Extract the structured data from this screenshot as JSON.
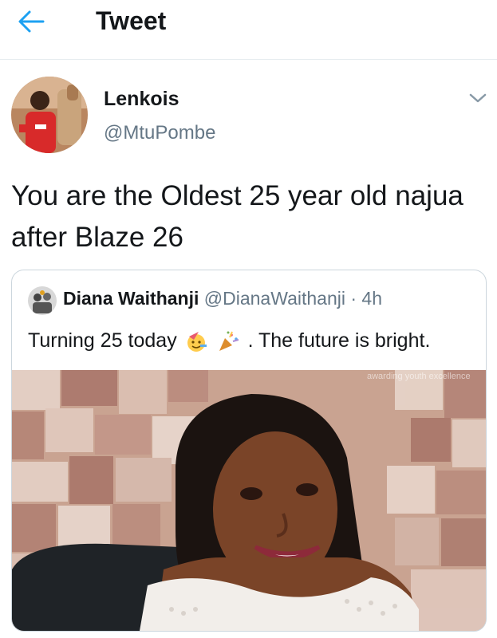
{
  "header": {
    "title": "Tweet",
    "back_icon": "arrow-left-icon",
    "accent": "#1da1f2"
  },
  "tweet": {
    "author_name": "Lenkois",
    "author_handle": "@MtuPombe",
    "text": "You are the Oldest 25 year old najua after Blaze 26",
    "menu_icon": "chevron-down-icon"
  },
  "quoted_tweet": {
    "author_name": "Diana Waithanji",
    "author_handle": "@DianaWaithanji",
    "separator": "·",
    "time": "4h",
    "text_before_emoji": "Turning 25 today",
    "emoji_1": "party-face-emoji",
    "emoji_2": "party-popper-emoji",
    "text_after_emoji": ". The future is bright.",
    "image_watermark": "awarding youth excellence"
  },
  "colors": {
    "text": "#14171a",
    "secondary": "#657786",
    "border": "#e6ecf0"
  }
}
